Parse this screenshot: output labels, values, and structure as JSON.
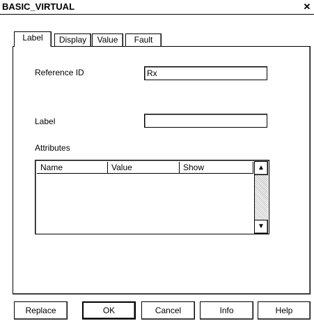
{
  "window": {
    "title": "BASIC_VIRTUAL",
    "close_glyph": "✕"
  },
  "tabs": [
    {
      "label": "Label"
    },
    {
      "label": "Display"
    },
    {
      "label": "Value"
    },
    {
      "label": "Fault"
    }
  ],
  "form": {
    "reference_id_label": "Reference ID",
    "reference_id_value": "Rx",
    "label_label": "Label",
    "label_value": "",
    "attributes_label": "Attributes"
  },
  "attributes_table": {
    "columns": [
      "Name",
      "Value",
      "Show"
    ],
    "rows": []
  },
  "buttons": {
    "replace": "Replace",
    "ok": "OK",
    "cancel": "Cancel",
    "info": "Info",
    "help": "Help"
  },
  "icons": {
    "scroll_up": "▲",
    "scroll_down": "▼"
  }
}
